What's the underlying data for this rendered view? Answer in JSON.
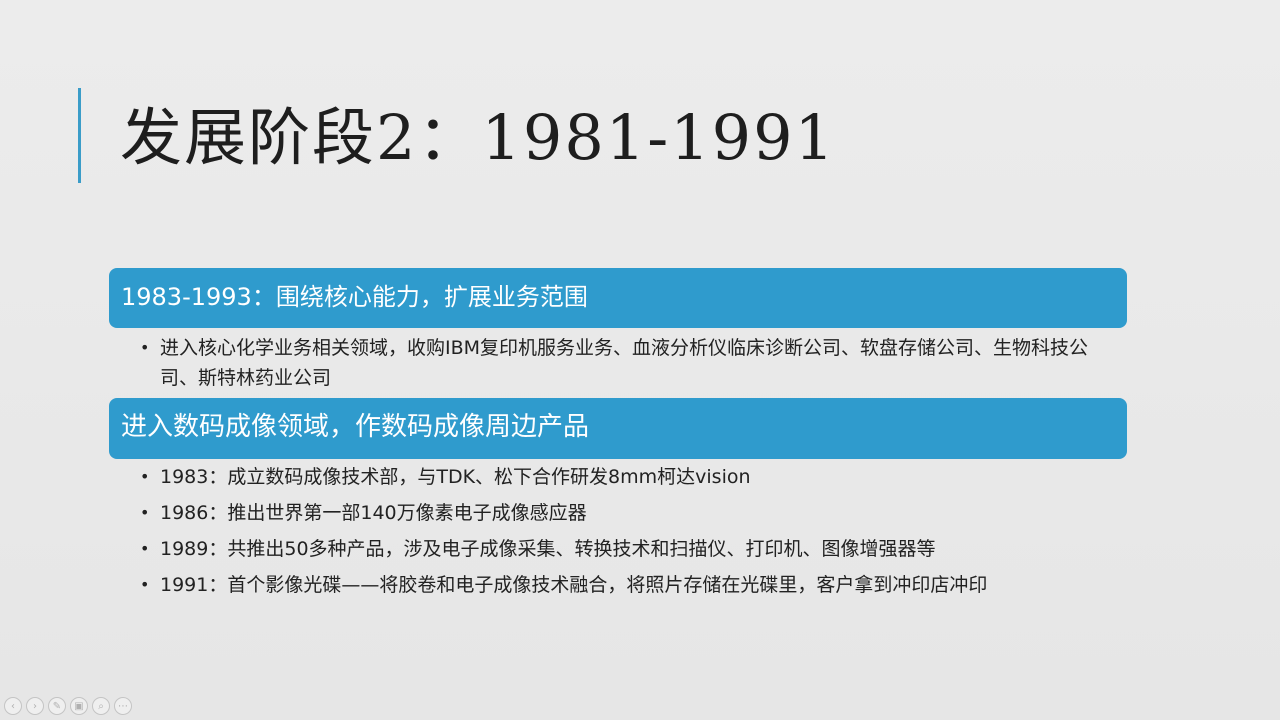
{
  "slide": {
    "title": "发展阶段2：1981-1991",
    "section1": {
      "heading": "1983-1993：围绕核心能力，扩展业务范围",
      "bullets": [
        "进入核心化学业务相关领域，收购IBM复印机服务业务、血液分析仪临床诊断公司、软盘存储公司、生物科技公司、斯特林药业公司"
      ]
    },
    "section2": {
      "heading": "进入数码成像领域，作数码成像周边产品",
      "bullets": [
        "1983：成立数码成像技术部，与TDK、松下合作研发8mm柯达vision",
        "1986：推出世界第一部140万像素电子成像感应器",
        "1989：共推出50多种产品，涉及电子成像采集、转换技术和扫描仪、打印机、图像增强器等",
        "1991：首个影像光碟——将胶卷和电子成像技术融合，将照片存储在光碟里，客户拿到冲印店冲印"
      ]
    },
    "bullet_glyph": "•"
  },
  "toolbar": {
    "buttons": [
      {
        "name": "previous-slide-button",
        "glyph": "‹"
      },
      {
        "name": "next-slide-button",
        "glyph": "›"
      },
      {
        "name": "pen-tool-button",
        "glyph": "✎"
      },
      {
        "name": "slide-sorter-button",
        "glyph": "▣"
      },
      {
        "name": "zoom-button",
        "glyph": "⌕"
      },
      {
        "name": "more-options-button",
        "glyph": "⋯"
      }
    ]
  },
  "colors": {
    "accent": "#2f9bcd",
    "background": "#e8e8e8",
    "text": "#222222"
  }
}
